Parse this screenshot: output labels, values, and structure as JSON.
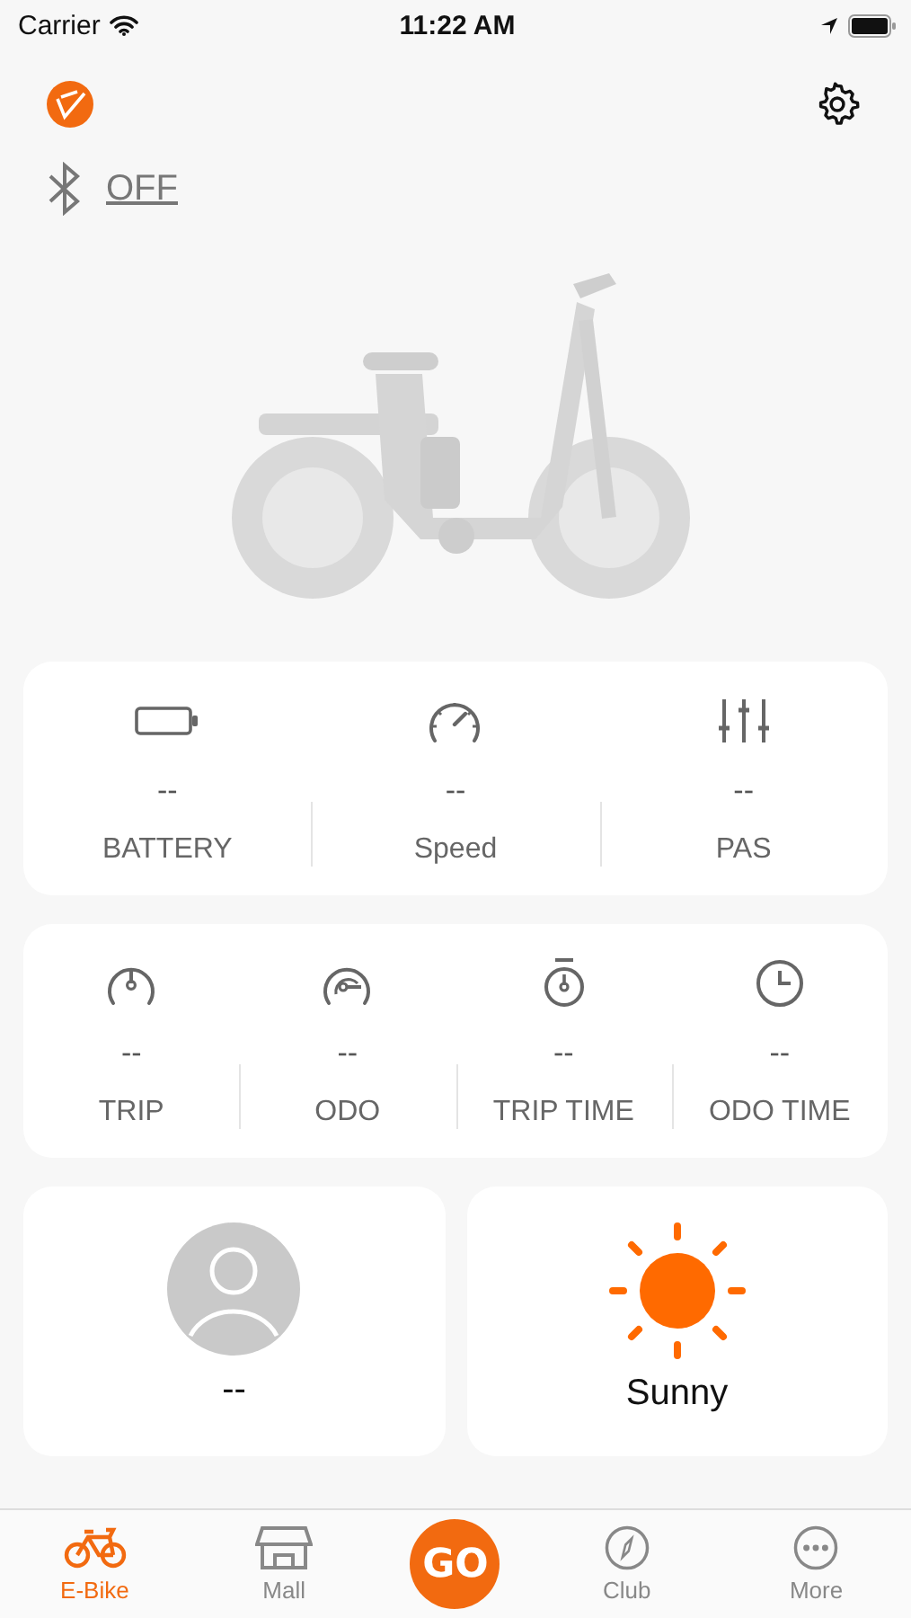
{
  "status_bar": {
    "carrier": "Carrier",
    "time": "11:22 AM"
  },
  "bluetooth": {
    "label": "OFF",
    "connected": false
  },
  "primary_stats": [
    {
      "kind": "battery",
      "value": "--",
      "label": "BATTERY"
    },
    {
      "kind": "speedometer",
      "value": "--",
      "label": "Speed"
    },
    {
      "kind": "sliders",
      "value": "--",
      "label": "PAS"
    }
  ],
  "trip_stats": [
    {
      "kind": "gauge",
      "value": "--",
      "label": "TRIP"
    },
    {
      "kind": "gauge-wide",
      "value": "--",
      "label": "ODO"
    },
    {
      "kind": "stopwatch",
      "value": "--",
      "label": "TRIP TIME"
    },
    {
      "kind": "clock",
      "value": "--",
      "label": "ODO TIME"
    }
  ],
  "rider": {
    "name": "--"
  },
  "weather": {
    "condition": "Sunny"
  },
  "tabs": [
    {
      "kind": "bike",
      "label": "E-Bike",
      "selected": true
    },
    {
      "kind": "store",
      "label": "Mall",
      "selected": false
    },
    {
      "kind": "go",
      "label": "GO",
      "selected": false
    },
    {
      "kind": "compass",
      "label": "Club",
      "selected": false
    },
    {
      "kind": "more",
      "label": "More",
      "selected": false
    }
  ]
}
